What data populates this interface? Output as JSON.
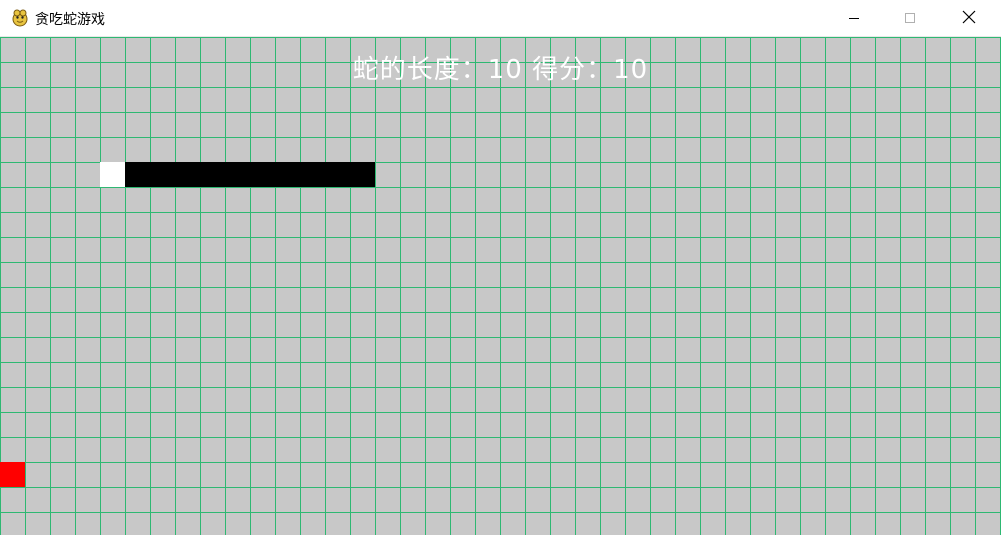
{
  "window": {
    "title": "贪吃蛇游戏",
    "icon": "snake-app-icon",
    "controls": [
      "minimize-icon",
      "maximize-icon",
      "close-icon"
    ]
  },
  "hud": {
    "length_label": "蛇的长度：",
    "length_value": "10",
    "score_label": "得分：",
    "score_value": "10"
  },
  "game": {
    "grid_cols": 40,
    "grid_rows": 20,
    "snake": {
      "head": [
        4,
        5
      ],
      "body": [
        [
          5,
          5
        ],
        [
          6,
          5
        ],
        [
          7,
          5
        ],
        [
          8,
          5
        ],
        [
          9,
          5
        ],
        [
          10,
          5
        ],
        [
          11,
          5
        ],
        [
          12,
          5
        ],
        [
          13,
          5
        ],
        [
          14,
          5
        ]
      ]
    },
    "food": [
      0,
      17
    ]
  },
  "colors": {
    "background": "#c8c8c8",
    "grid_line": "#2eb872",
    "snake_head": "#ffffff",
    "snake_body": "#000000",
    "food": "#ff0000",
    "hud_text": "#ffffff"
  }
}
